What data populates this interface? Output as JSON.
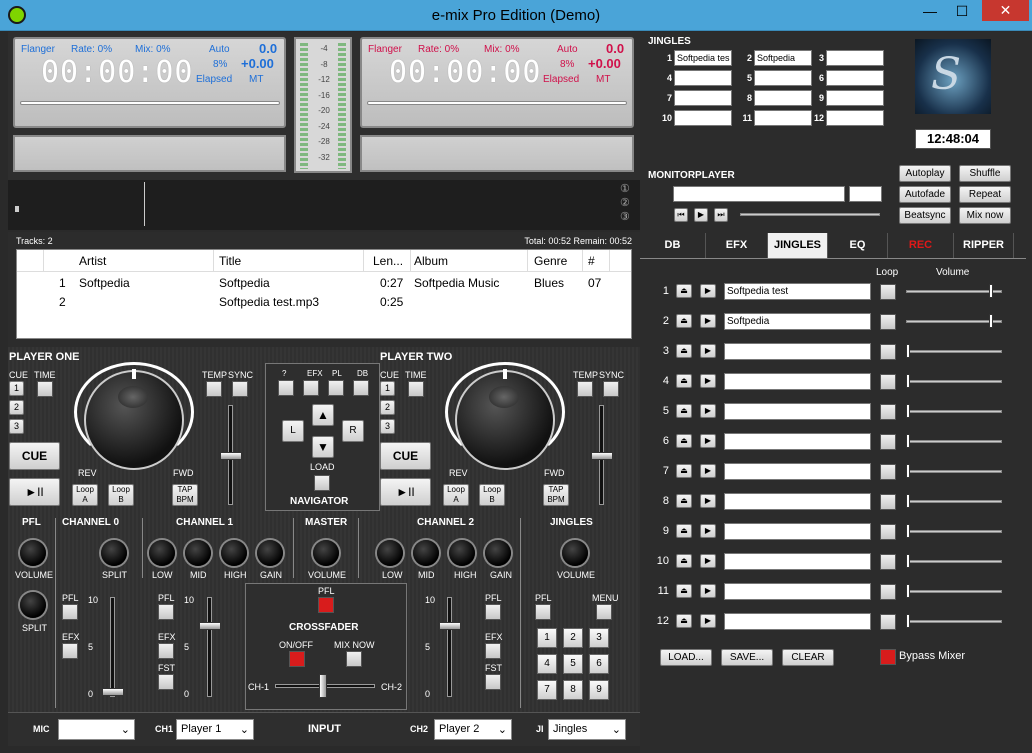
{
  "window": {
    "title": "e-mix Pro Edition (Demo)",
    "minimize": "—",
    "maximize": "☐",
    "close": "✕"
  },
  "player1": {
    "effect": "Flanger",
    "rate": "Rate: 0%",
    "mix": "Mix: 0%",
    "mode": "Auto",
    "val1": "0.0",
    "pct": "8%",
    "val2": "+0.00",
    "time": "00:00:00",
    "elapsed": "Elapsed",
    "mt": "MT"
  },
  "player2": {
    "effect": "Flanger",
    "rate": "Rate: 0%",
    "mix": "Mix: 0%",
    "mode": "Auto",
    "val1": "0.0",
    "pct": "8%",
    "val2": "+0.00",
    "time": "00:00:00",
    "elapsed": "Elapsed",
    "mt": "MT"
  },
  "vu": {
    "labels": [
      "-4",
      "-8",
      "-12",
      "-16",
      "-20",
      "-24",
      "-28",
      "-32"
    ]
  },
  "jingles_panel": {
    "title": "JINGLES",
    "slots": [
      {
        "n": "1",
        "v": "Softpedia tes"
      },
      {
        "n": "2",
        "v": "Softpedia"
      },
      {
        "n": "3",
        "v": ""
      },
      {
        "n": "4",
        "v": ""
      },
      {
        "n": "5",
        "v": ""
      },
      {
        "n": "6",
        "v": ""
      },
      {
        "n": "7",
        "v": ""
      },
      {
        "n": "8",
        "v": ""
      },
      {
        "n": "9",
        "v": ""
      },
      {
        "n": "10",
        "v": ""
      },
      {
        "n": "11",
        "v": ""
      },
      {
        "n": "12",
        "v": ""
      }
    ]
  },
  "clock": "12:48:04",
  "auto_buttons": [
    "Autoplay",
    "Shuffle",
    "Autofade",
    "Repeat",
    "Beatsync",
    "Mix now"
  ],
  "monitor": {
    "title": "MONITORPLAYER"
  },
  "markers": [
    "①",
    "②",
    "③"
  ],
  "playlist": {
    "tracks_label": "Tracks: 2",
    "total_label": "Total: 00:52 Remain: 00:52",
    "columns": [
      "Artist",
      "Title",
      "Len...",
      "Album",
      "Genre",
      "#"
    ],
    "rows": [
      {
        "n": "1",
        "artist": "Softpedia",
        "title": "Softpedia",
        "len": "0:27",
        "album": "Softpedia Music",
        "genre": "Blues",
        "num": "07"
      },
      {
        "n": "2",
        "artist": "",
        "title": "Softpedia test.mp3",
        "len": "0:25",
        "album": "",
        "genre": "",
        "num": ""
      }
    ]
  },
  "deck1": {
    "title": "PLAYER ONE",
    "cue": "CUE",
    "time": "TIME",
    "temp": "TEMP",
    "sync": "SYNC",
    "cue_btn": "CUE",
    "play": "►II",
    "rev": "REV",
    "fwd": "FWD",
    "loopa": "Loop A",
    "loopb": "Loop B",
    "tap": "TAP BPM",
    "nums": [
      "1",
      "2",
      "3"
    ]
  },
  "deck2": {
    "title": "PLAYER TWO",
    "cue": "CUE",
    "time": "TIME",
    "temp": "TEMP",
    "sync": "SYNC",
    "cue_btn": "CUE",
    "play": "►II",
    "rev": "REV",
    "fwd": "FWD",
    "loopa": "Loop A",
    "loopb": "Loop B",
    "tap": "TAP BPM",
    "nums": [
      "1",
      "2",
      "3"
    ]
  },
  "navigator": {
    "title": "NAVIGATOR",
    "top": [
      "?",
      "EFX",
      "PL",
      "DB"
    ],
    "l": "L",
    "r": "R",
    "load": "LOAD",
    "up": "▲",
    "down": "▼"
  },
  "mixer": {
    "pfl": "PFL",
    "volume": "VOLUME",
    "split": "SPLIT",
    "ch0": "CHANNEL 0",
    "ch1": "CHANNEL 1",
    "master": "MASTER",
    "ch2": "CHANNEL 2",
    "jingles": "JINGLES",
    "low": "LOW",
    "mid": "MID",
    "high": "HIGH",
    "gain": "GAIN",
    "efx": "EFX",
    "fst": "FST",
    "crossfader": "CROSSFADER",
    "onoff": "ON/OFF",
    "mixnow": "MIX NOW",
    "cha": "CH-1",
    "chb": "CH-2",
    "menu": "MENU",
    "scale": [
      "10",
      "5",
      "0"
    ],
    "keys": [
      "1",
      "2",
      "3",
      "4",
      "5",
      "6",
      "7",
      "8",
      "9"
    ]
  },
  "bottom": {
    "mic": "MIC",
    "ch1": "CH1",
    "ch1_val": "Player 1",
    "input": "INPUT",
    "ch2": "CH2",
    "ch2_val": "Player 2",
    "ji": "JI",
    "ji_val": "Jingles"
  },
  "tabs": [
    "DB",
    "EFX",
    "JINGLES",
    "EQ",
    "REC",
    "RIPPER"
  ],
  "jingle_list": {
    "loop": "Loop",
    "volume": "Volume",
    "rows": [
      {
        "n": "1",
        "v": "Softpedia test",
        "vol": 0.85
      },
      {
        "n": "2",
        "v": "Softpedia",
        "vol": 0.85
      },
      {
        "n": "3",
        "v": "",
        "vol": 0.0
      },
      {
        "n": "4",
        "v": "",
        "vol": 0.0
      },
      {
        "n": "5",
        "v": "",
        "vol": 0.0
      },
      {
        "n": "6",
        "v": "",
        "vol": 0.0
      },
      {
        "n": "7",
        "v": "",
        "vol": 0.0
      },
      {
        "n": "8",
        "v": "",
        "vol": 0.0
      },
      {
        "n": "9",
        "v": "",
        "vol": 0.0
      },
      {
        "n": "10",
        "v": "",
        "vol": 0.0
      },
      {
        "n": "11",
        "v": "",
        "vol": 0.0
      },
      {
        "n": "12",
        "v": "",
        "vol": 0.0
      }
    ],
    "load": "LOAD...",
    "save": "SAVE...",
    "clear": "CLEAR",
    "bypass": "Bypass Mixer"
  },
  "colors": {
    "accent_blue": "#1e6fd8",
    "accent_red": "#d0104a",
    "rec": "#e01818"
  }
}
